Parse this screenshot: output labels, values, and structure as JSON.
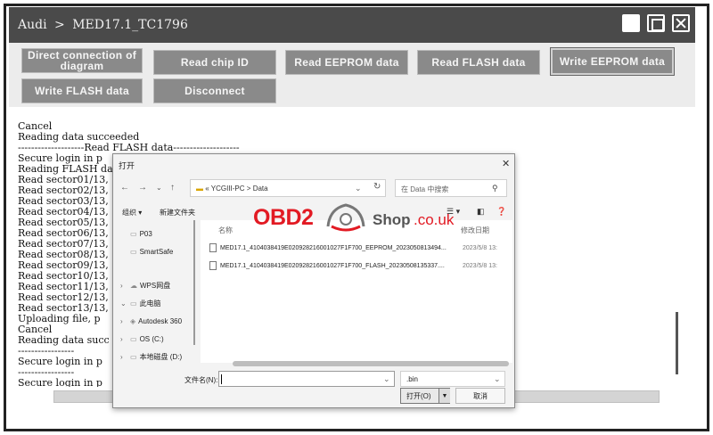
{
  "titlebar": {
    "crumb_root": "Audi",
    "separator": ">",
    "crumb_current": "MED17.1_TC1796"
  },
  "buttons": {
    "direct_connection": "Direct connection of diagram",
    "read_chip_id": "Read chip ID",
    "read_eeprom": "Read EEPROM data",
    "read_flash": "Read FLASH data",
    "write_eeprom": "Write EEPROM data",
    "write_flash": "Write FLASH data",
    "disconnect": "Disconnect"
  },
  "log": {
    "lines": [
      "Cancel",
      "Reading data succeeded",
      "--------------------Read FLASH data--------------------",
      "Secure login in p",
      "Reading FLASH dat",
      "Read sector01/13,",
      "Read sector02/13,",
      "Read sector03/13,",
      "Read sector04/13,",
      "Read sector05/13,",
      "Read sector06/13,",
      "Read sector07/13,",
      "Read sector08/13,",
      "Read sector09/13,",
      "Read sector10/13,",
      "Read sector11/13,",
      "Read sector12/13,",
      "Read sector13/13,",
      "Uploading file, p",
      "Cancel",
      "Reading data succ",
      "-----------------",
      "Secure login in p",
      "-----------------",
      "Secure login in p"
    ]
  },
  "dialog": {
    "title": "打开",
    "address": {
      "prefix": "«",
      "segment1": "YCGIII-PC",
      "sep": ">",
      "segment2": "Data"
    },
    "search_placeholder": "在 Data 中搜索",
    "organize": "组织 ▾",
    "new_folder": "新建文件夹",
    "columns": {
      "name": "名称",
      "modified": "修改日期"
    },
    "sidebar": [
      {
        "label": "P03",
        "chevron": "",
        "icon": "▭"
      },
      {
        "label": "SmartSafe",
        "chevron": "",
        "icon": "▭"
      },
      {
        "label": "WPS网盘",
        "chevron": "›",
        "icon": "☁"
      },
      {
        "label": "此电脑",
        "chevron": "⌄",
        "icon": "▭"
      },
      {
        "label": "Autodesk 360",
        "chevron": "›",
        "icon": "◈"
      },
      {
        "label": "OS (C:)",
        "chevron": "›",
        "icon": "▭"
      },
      {
        "label": "本地磁盘 (D:)",
        "chevron": "›",
        "icon": "▭"
      }
    ],
    "files": [
      {
        "name": "MED17.1_4104038419E020928216001027F1F700_EEPROM_2023050813494...",
        "date": "2023/5/8 13:"
      },
      {
        "name": "MED17.1_4104038419E020928216001027F1F700_FLASH_20230508135337....",
        "date": "2023/5/8 13:"
      }
    ],
    "filename_label": "文件名(N):",
    "filename_value": "",
    "filetype": ".bin",
    "open_label": "打开(O)",
    "cancel_label": "取消"
  },
  "watermark": {
    "brand": "OBD2",
    "shop": "Shop",
    "tld": ".co.uk"
  }
}
